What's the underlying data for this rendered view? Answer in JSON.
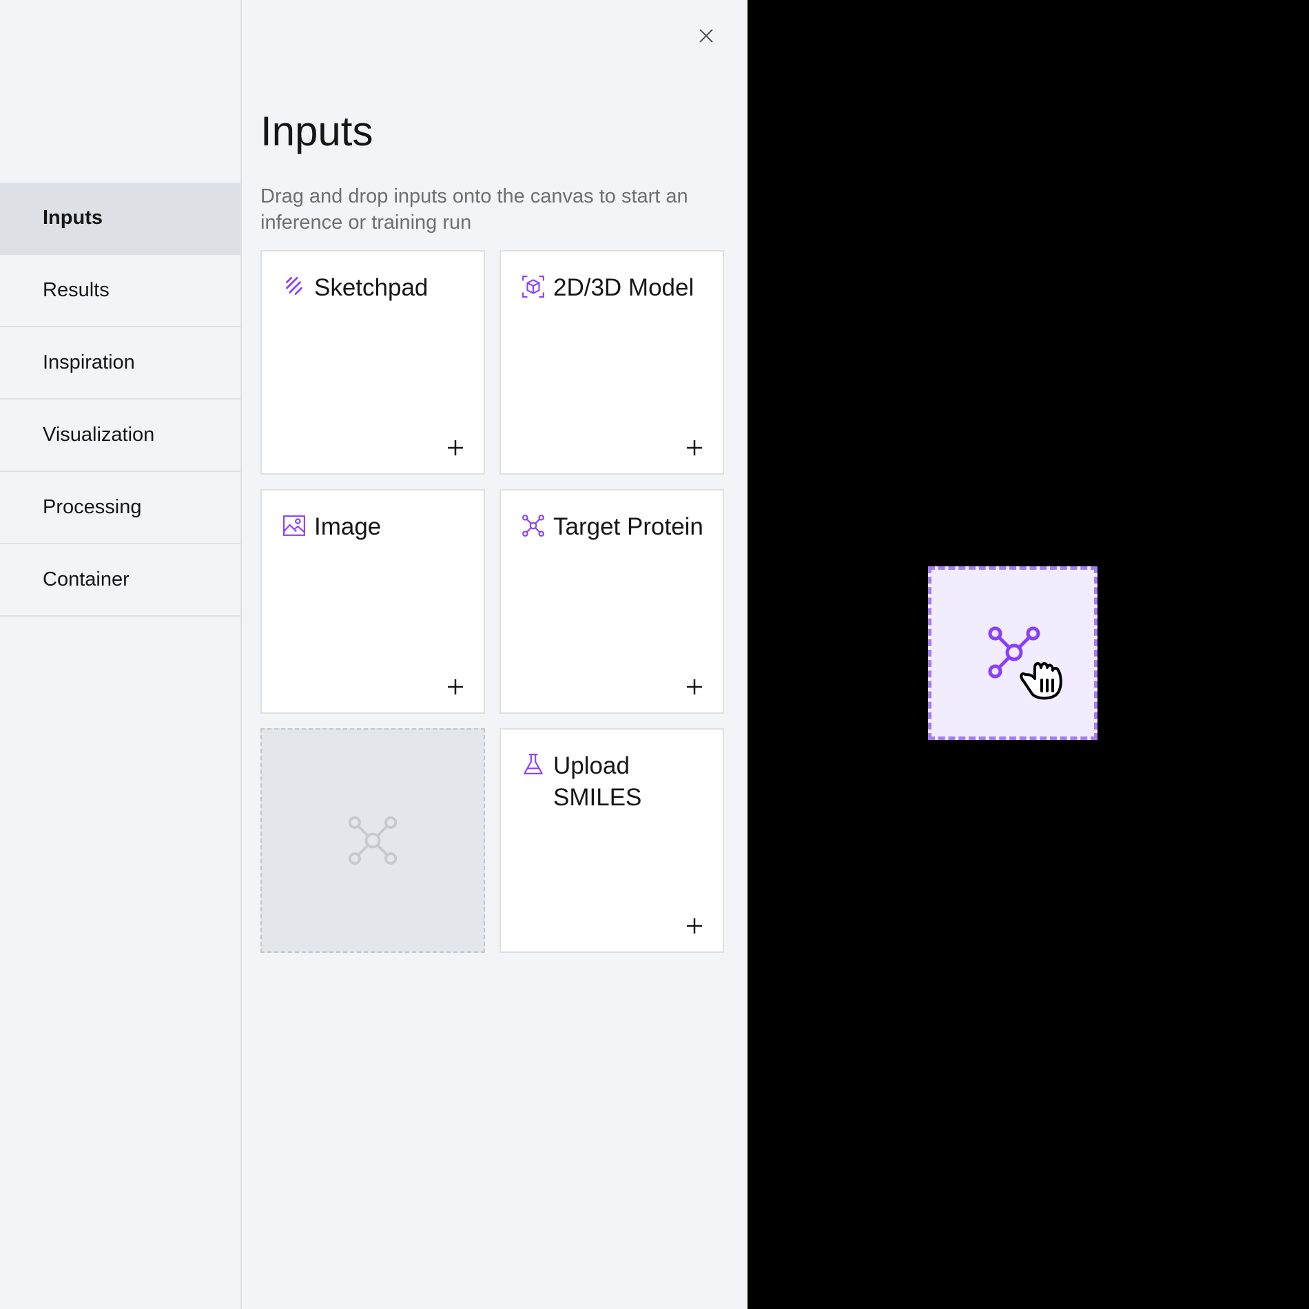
{
  "sidebar": {
    "items": [
      {
        "label": "Inputs",
        "active": true
      },
      {
        "label": "Results"
      },
      {
        "label": "Inspiration"
      },
      {
        "label": "Visualization"
      },
      {
        "label": "Processing"
      },
      {
        "label": "Container"
      }
    ]
  },
  "panel": {
    "title": "Inputs",
    "description": "Drag and drop inputs onto the canvas to start an inference or training run",
    "close_icon": "close-icon",
    "tiles": [
      {
        "label": "Sketchpad",
        "icon": "sketch-icon",
        "action_icon": "plus-icon"
      },
      {
        "label": "2D/3D Model",
        "icon": "cube-model-icon",
        "action_icon": "plus-icon"
      },
      {
        "label": "Image",
        "icon": "image-icon",
        "action_icon": "plus-icon"
      },
      {
        "label": "Target Protein",
        "icon": "molecule-icon",
        "action_icon": "plus-icon"
      },
      {
        "state": "drag-placeholder",
        "icon": "molecule-icon"
      },
      {
        "label": "Upload SMILES",
        "icon": "chemistry-flask-icon",
        "action_icon": "plus-icon"
      }
    ]
  },
  "canvas": {
    "dragging_item": {
      "icon": "molecule-icon",
      "cursor": "grab-hand-icon"
    }
  },
  "colors": {
    "accent": "#8a3ffc",
    "active_nav": "#dde1e6",
    "panel_bg": "#f2f4f8",
    "drag_border": "#a47ef0",
    "drag_bg": "#f1ecfe"
  }
}
